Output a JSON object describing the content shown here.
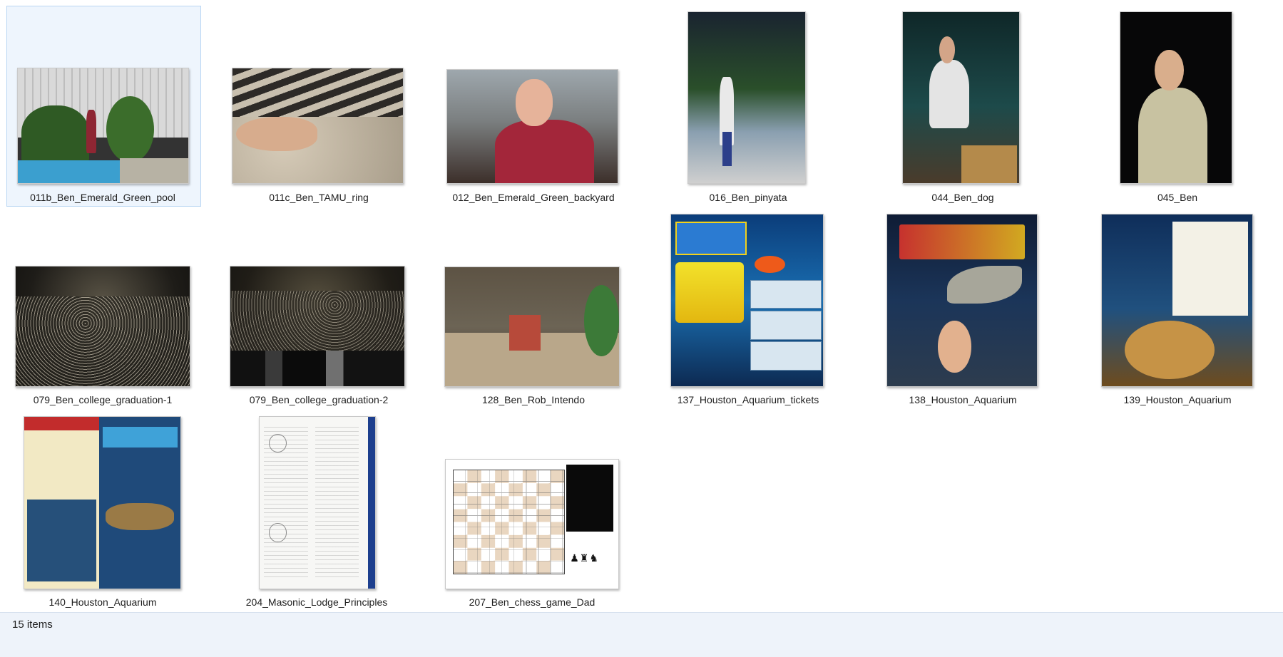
{
  "items": [
    {
      "name": "011b_Ben_Emerald_Green_pool",
      "selected": true
    },
    {
      "name": "011c_Ben_TAMU_ring"
    },
    {
      "name": "012_Ben_Emerald_Green_backyard"
    },
    {
      "name": "016_Ben_pinyata"
    },
    {
      "name": "044_Ben_dog"
    },
    {
      "name": "045_Ben"
    },
    {
      "name": "079_Ben_college_graduation-1"
    },
    {
      "name": "079_Ben_college_graduation-2"
    },
    {
      "name": "128_Ben_Rob_Intendo"
    },
    {
      "name": "137_Houston_Aquarium_tickets"
    },
    {
      "name": "138_Houston_Aquarium"
    },
    {
      "name": "139_Houston_Aquarium"
    },
    {
      "name": "140_Houston_Aquarium"
    },
    {
      "name": "204_Masonic_Lodge_Principles"
    },
    {
      "name": "207_Ben_chess_game_Dad"
    }
  ],
  "status": {
    "item_count": "15 items"
  },
  "colors": {
    "selection_bg": "#eef5fd",
    "selection_border": "#b9d6f3",
    "statusbar_bg": "#eef3fa"
  }
}
